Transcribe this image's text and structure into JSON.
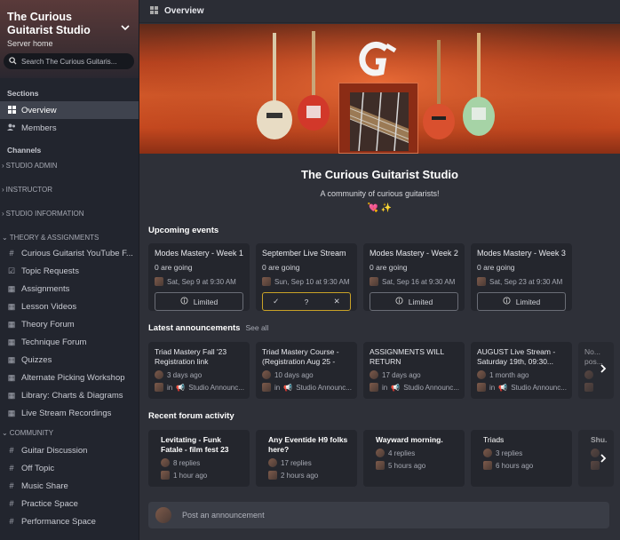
{
  "server": {
    "title": "The Curious Guitarist Studio",
    "subtitle": "Server home",
    "search_placeholder": "Search The Curious Guitaris..."
  },
  "sections_header": "Sections",
  "sections": [
    {
      "label": "Overview",
      "icon": "grid-icon",
      "active": true
    },
    {
      "label": "Members",
      "icon": "members-icon",
      "active": false
    }
  ],
  "channels_header": "Channels",
  "categories": {
    "studio_admin": "STUDIO ADMIN",
    "instructor": "INSTRUCTOR",
    "studio_information": "STUDIO INFORMATION",
    "theory": "THEORY & ASSIGNMENTS",
    "community": "COMMUNITY"
  },
  "theory_channels": [
    {
      "label": "Curious Guitarist YouTube F...",
      "icon": "#"
    },
    {
      "label": "Topic Requests",
      "icon": "☑"
    },
    {
      "label": "Assignments",
      "icon": "▦"
    },
    {
      "label": "Lesson Videos",
      "icon": "▦"
    },
    {
      "label": "Theory Forum",
      "icon": "▦"
    },
    {
      "label": "Technique Forum",
      "icon": "▦"
    },
    {
      "label": "Quizzes",
      "icon": "▦"
    },
    {
      "label": "Alternate Picking Workshop",
      "icon": "▦"
    },
    {
      "label": "Library: Charts & Diagrams",
      "icon": "▦"
    },
    {
      "label": "Live Stream Recordings",
      "icon": "▦"
    }
  ],
  "community_channels": [
    {
      "label": "Guitar Discussion",
      "icon": "#"
    },
    {
      "label": "Off Topic",
      "icon": "#"
    },
    {
      "label": "Music Share",
      "icon": "#"
    },
    {
      "label": "Practice Space",
      "icon": "#"
    },
    {
      "label": "Performance Space",
      "icon": "#"
    }
  ],
  "topbar": {
    "title": "Overview"
  },
  "community": {
    "title": "The Curious Guitarist Studio",
    "tagline": "A community of curious guitarists!",
    "emojis": "💘 ✨"
  },
  "events_header": "Upcoming events",
  "events": [
    {
      "title": "Modes Mastery - Week 1",
      "going": "0 are going",
      "date": "Sat, Sep 9 at 9:30 AM",
      "button": "Limited"
    },
    {
      "title": "September Live Stream",
      "going": "0 are going",
      "date": "Sun, Sep 10 at 9:30 AM",
      "rsvp": [
        "✓",
        "?",
        "✕"
      ]
    },
    {
      "title": "Modes Mastery - Week 2",
      "going": "0 are going",
      "date": "Sat, Sep 16 at 9:30 AM",
      "button": "Limited"
    },
    {
      "title": "Modes Mastery - Week 3",
      "going": "0 are going",
      "date": "Sat, Sep 23 at 9:30 AM",
      "button": "Limited"
    }
  ],
  "announcements_header": "Latest announcements",
  "see_all": "See all",
  "announcements": [
    {
      "title": "Triad Mastery Fall '23 Registration link",
      "age": "3 days ago",
      "channel": "Studio Announc..."
    },
    {
      "title": "Triad Mastery Course - (Registration Aug 25 -",
      "age": "10 days ago",
      "channel": "Studio Announc..."
    },
    {
      "title": "ASSIGNMENTS WILL RETURN",
      "age": "17 days ago",
      "channel": "Studio Announc..."
    },
    {
      "title": "AUGUST Live Stream - Saturday 19th, 09:30...",
      "age": "1 month ago",
      "channel": "Studio Announc..."
    },
    {
      "title": "No... pos...",
      "age": "",
      "channel": ""
    }
  ],
  "forum_header": "Recent forum activity",
  "forum": [
    {
      "title": "Levitating - Funk Fatale - film fest 23",
      "replies": "8 replies",
      "age": "1 hour ago",
      "bold": true
    },
    {
      "title": "Any Eventide H9 folks here?",
      "replies": "17 replies",
      "age": "2 hours ago",
      "bold": true
    },
    {
      "title": "Wayward morning.",
      "replies": "4 replies",
      "age": "5 hours ago",
      "bold": true
    },
    {
      "title": "Triads",
      "replies": "3 replies",
      "age": "6 hours ago",
      "bold": false
    },
    {
      "title": "Shu...",
      "replies": "",
      "age": "",
      "bold": true
    }
  ],
  "post_placeholder": "Post an announcement",
  "in_label": "in"
}
